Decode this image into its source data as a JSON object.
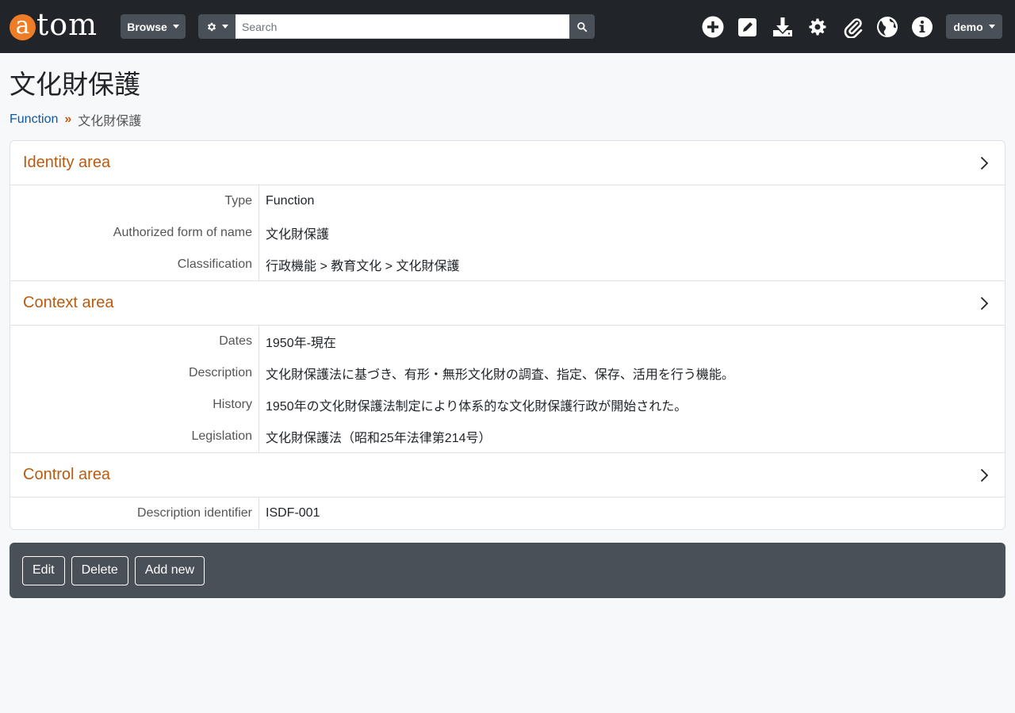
{
  "navbar": {
    "logo_first": "a",
    "logo_rest": "tom",
    "browse_label": "Browse",
    "search_placeholder": "Search",
    "user_label": "demo",
    "icons": [
      "add-icon",
      "edit-icon",
      "import-icon",
      "settings-icon",
      "clipboard-icon",
      "language-icon",
      "info-icon"
    ]
  },
  "page": {
    "title": "文化財保護",
    "breadcrumb": {
      "parent": "Function",
      "separator": "»",
      "current": "文化財保護"
    }
  },
  "sections": {
    "identity": {
      "title": "Identity area",
      "fields": [
        {
          "label": "Type",
          "value": "Function"
        },
        {
          "label": "Authorized form of name",
          "value": "文化財保護"
        },
        {
          "label": "Classification",
          "value": "行政機能 > 教育文化 > 文化財保護"
        }
      ]
    },
    "context": {
      "title": "Context area",
      "fields": [
        {
          "label": "Dates",
          "value": "1950年-現在"
        },
        {
          "label": "Description",
          "value": "文化財保護法に基づき、有形・無形文化財の調査、指定、保存、活用を行う機能。"
        },
        {
          "label": "History",
          "value": "1950年の文化財保護法制定により体系的な文化財保護行政が開始された。"
        },
        {
          "label": "Legislation",
          "value": "文化財保護法（昭和25年法律第214号）"
        }
      ]
    },
    "control": {
      "title": "Control area",
      "fields": [
        {
          "label": "Description identifier",
          "value": "ISDF-001"
        }
      ]
    }
  },
  "actions": {
    "edit": "Edit",
    "delete": "Delete",
    "add_new": "Add new"
  },
  "colors": {
    "navbar_bg": "#212529",
    "logo_accent": "#ef7c26",
    "section_title": "#b85b10",
    "link": "#0d58a6",
    "actions_bg": "#495057"
  }
}
